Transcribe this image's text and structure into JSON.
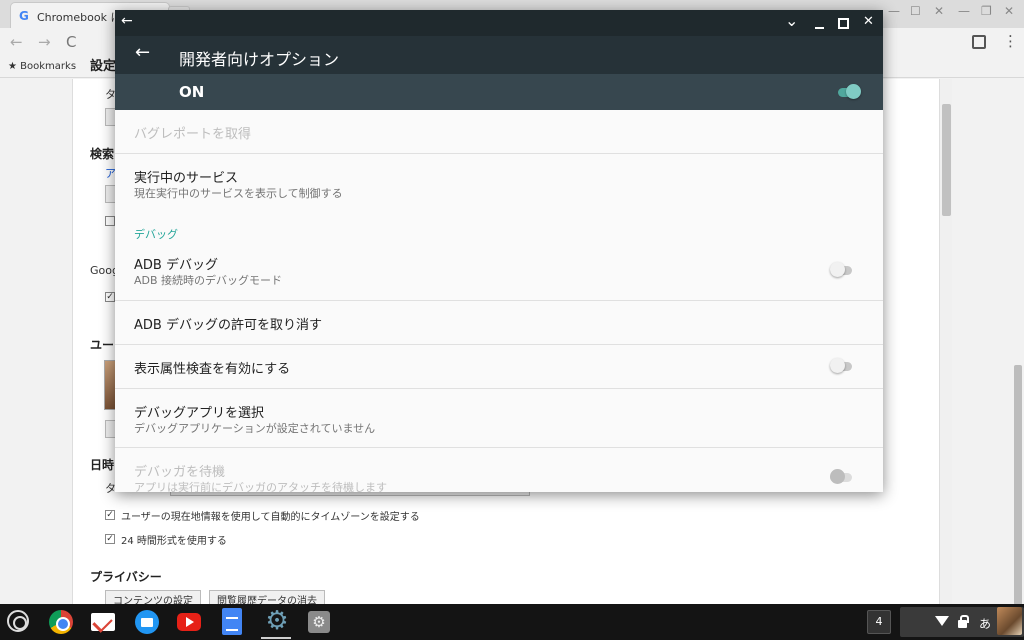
{
  "browser": {
    "tab_title": "Chromebook に ...",
    "bookmarks_label": "Bookmarks",
    "google_g": "G"
  },
  "settings_page": {
    "title": "設定",
    "section_search": "検索",
    "section_google": "Goog",
    "section_users": "ユー",
    "section_datetime": "日時",
    "label_ta1": "タ",
    "label_ta2": "タ",
    "link_a": "ア",
    "tz_auto_label": "ユーザーの現在地情報を使用して自動的にタイムゾーンを設定する",
    "tz_auto_checked": true,
    "hour24_label": "24 時間形式を使用する",
    "hour24_checked": true,
    "privacy_heading": "プライバシー",
    "content_settings_button": "コンテンツの設定",
    "clear_history_button": "閲覧履歴データの消去"
  },
  "android_window": {
    "titlebar_back": "←",
    "titlebar_chevron": "⌄",
    "titlebar_close": "✕",
    "app_bar": {
      "back": "←",
      "title": "開発者向けオプション"
    },
    "master_switch": {
      "label": "ON",
      "on": true
    },
    "preferences": {
      "bug_report": {
        "title": "バグレポートを取得",
        "enabled": false
      },
      "running_services": {
        "title": "実行中のサービス",
        "summary": "現在実行中のサービスを表示して制御する"
      },
      "debug_category": "デバッグ",
      "adb_debugging": {
        "title": "ADB デバッグ",
        "summary": "ADB 接続時のデバッグモード",
        "on": false
      },
      "revoke_adb": {
        "title": "ADB デバッグの許可を取り消す"
      },
      "view_attribute": {
        "title": "表示属性検査を有効にする",
        "on": false
      },
      "debug_app": {
        "title": "デバッグアプリを選択",
        "summary": "デバッグアプリケーションが設定されていません"
      },
      "wait_debugger": {
        "title": "デバッガを待機",
        "summary": "アプリは実行前にデバッガのアタッチを待機します",
        "enabled": false
      }
    }
  },
  "shelf": {
    "apps": [
      "launcher-icon",
      "chrome-icon",
      "gmail-icon",
      "files-icon",
      "youtube-icon",
      "docs-icon",
      "settings-icon",
      "android-settings-icon"
    ],
    "notification_count": "4",
    "ime_indicator": "あ",
    "settings_glyph": "⚙",
    "android_glyph": "⚙"
  },
  "colors": {
    "appbar": "#263238",
    "master_bar": "#37474f",
    "accent": "#26a69a",
    "switch_on": "#80cbc4"
  }
}
